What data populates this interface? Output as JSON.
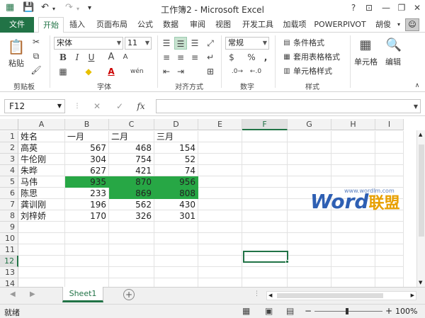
{
  "window": {
    "title": "工作簿2 - Microsoft Excel",
    "help": "?",
    "minimize": "—",
    "restore": "❐",
    "close": "✕"
  },
  "tabs": {
    "file": "文件",
    "home": "开始",
    "insert": "插入",
    "page_layout": "页面布局",
    "formulas": "公式",
    "data": "数据",
    "review": "审阅",
    "view": "视图",
    "developer": "开发工具",
    "addins": "加载项",
    "powerpivot": "POWERPIVOT",
    "user": "胡俊"
  },
  "ribbon": {
    "clipboard": {
      "paste": "粘贴",
      "group": "剪贴板"
    },
    "font": {
      "name": "宋体",
      "size": "11",
      "bold": "B",
      "italic": "I",
      "underline": "U",
      "grow": "A",
      "shrink": "A",
      "group": "字体",
      "phonetic": "wén"
    },
    "alignment": {
      "group": "对齐方式"
    },
    "number": {
      "format": "常规",
      "percent": "%",
      "comma": ",",
      "group": "数字"
    },
    "styles": {
      "conditional": "条件格式",
      "table": "套用表格格式",
      "cell": "单元格样式",
      "group": "样式"
    },
    "cells": {
      "label": "单元格"
    },
    "editing": {
      "label": "编辑"
    }
  },
  "formula_bar": {
    "name_box": "F12",
    "fx": "fx",
    "cancel": "✕",
    "enter": "✓",
    "content": ""
  },
  "columns": [
    "A",
    "B",
    "C",
    "D",
    "E",
    "F",
    "G",
    "H",
    "I"
  ],
  "rows": [
    "1",
    "2",
    "3",
    "4",
    "5",
    "6",
    "7",
    "8",
    "9",
    "10",
    "11",
    "12",
    "13",
    "14"
  ],
  "table": {
    "header": [
      "姓名",
      "一月",
      "二月",
      "三月"
    ],
    "data": [
      [
        "高英",
        "567",
        "468",
        "154"
      ],
      [
        "牛伦刚",
        "304",
        "754",
        "52"
      ],
      [
        "朱晔",
        "627",
        "421",
        "74"
      ],
      [
        "马伟",
        "935",
        "870",
        "956"
      ],
      [
        "陈思",
        "233",
        "869",
        "808"
      ],
      [
        "龚训刚",
        "196",
        "562",
        "430"
      ],
      [
        "刘梓娇",
        "170",
        "326",
        "301"
      ]
    ]
  },
  "highlight_color": "#27a745",
  "accent_color": "#217346",
  "sheet": {
    "tab": "Sheet1",
    "add": "+"
  },
  "status": {
    "ready": "就绪",
    "zoom": "100%",
    "zoom_out": "−",
    "zoom_in": "+"
  },
  "watermark": {
    "word": "Word",
    "cn": "联盟",
    "url": "www.wordlm.com"
  }
}
